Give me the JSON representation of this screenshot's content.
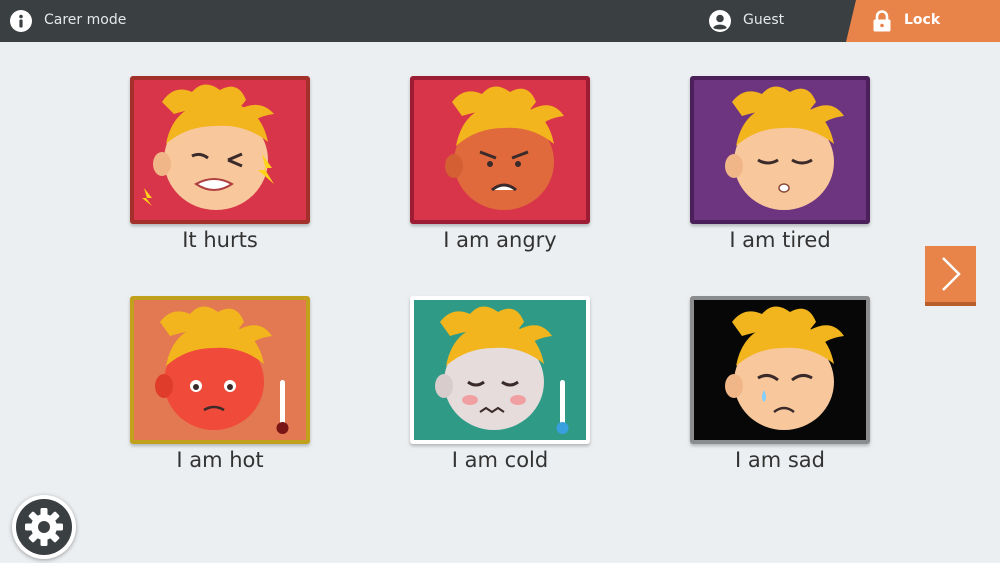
{
  "topbar": {
    "mode_label": "Carer mode",
    "mode_icon": "info-icon",
    "user_label": "Guest",
    "user_icon": "user-icon",
    "lock_label": "Lock",
    "lock_icon": "lock-icon",
    "accent": "#e8834a",
    "background": "#3a3f42"
  },
  "cards": [
    {
      "label": "It hurts",
      "bg": "#d8354b",
      "border": "#a4302c",
      "face": "hurt",
      "icon": "hurting-child-icon"
    },
    {
      "label": "I am angry",
      "bg": "#d8354b",
      "border": "#9b1c33",
      "face": "angry",
      "icon": "angry-child-icon"
    },
    {
      "label": "I am tired",
      "bg": "#6d3580",
      "border": "#4a1f5a",
      "face": "tired",
      "icon": "tired-child-icon"
    },
    {
      "label": "I am hot",
      "bg": "#e27952",
      "border": "#c1a11b",
      "face": "hot",
      "icon": "hot-child-icon"
    },
    {
      "label": "I am cold",
      "bg": "#2f9b87",
      "border": "#ffffff",
      "face": "cold",
      "icon": "cold-child-icon"
    },
    {
      "label": "I am sad",
      "bg": "#070707",
      "border": "#8a8c8e",
      "face": "sad",
      "icon": "sad-child-icon"
    }
  ],
  "navigation": {
    "next_icon": "chevron-right-icon"
  },
  "settings": {
    "icon": "gear-icon"
  }
}
